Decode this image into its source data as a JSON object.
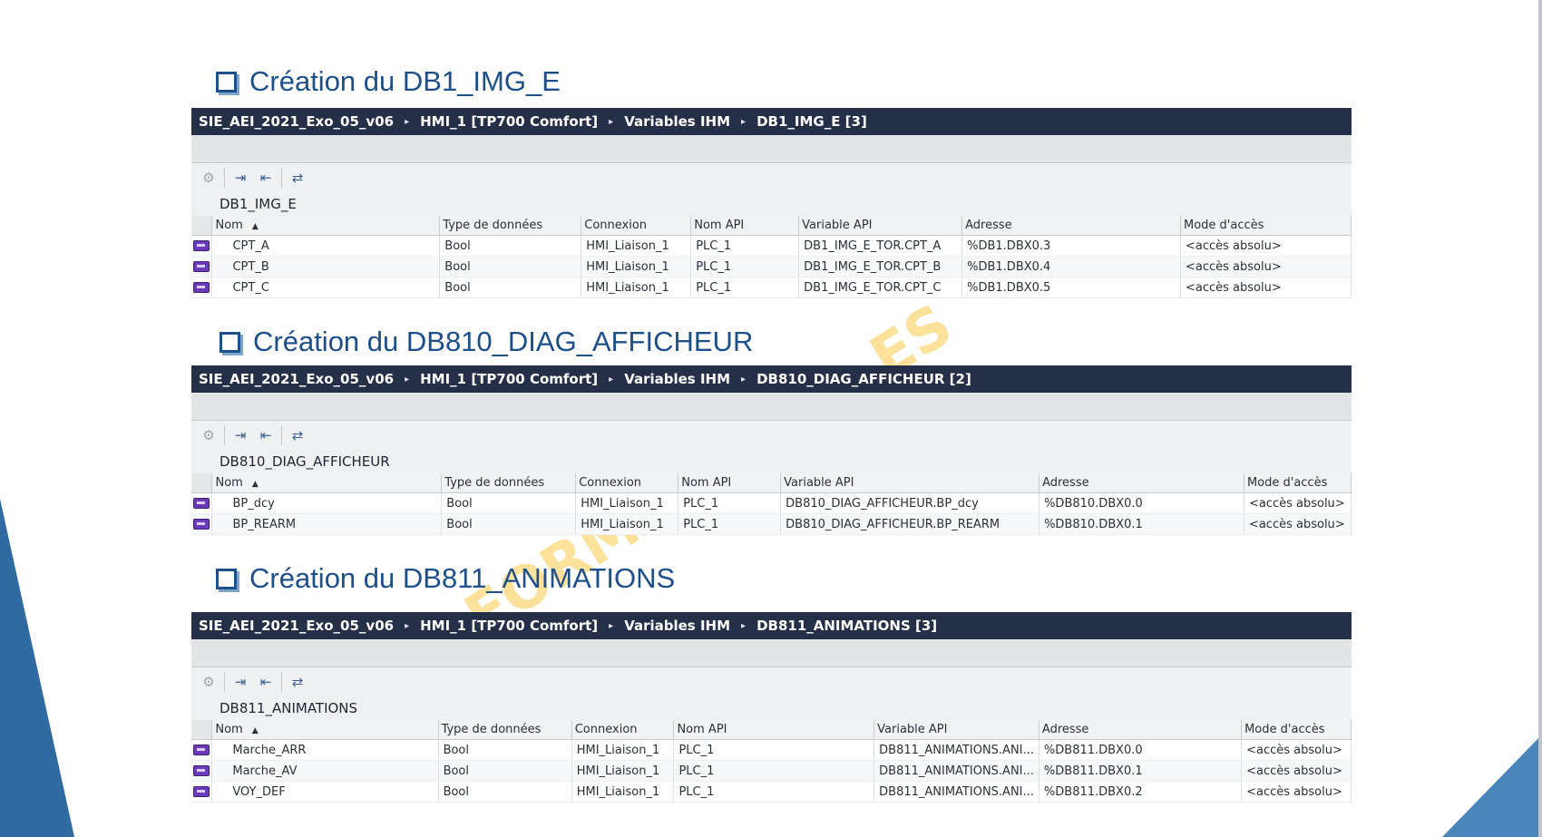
{
  "colors": {
    "title_blue": "#1d4f8a",
    "breadcrumb_bg": "#252f47",
    "accent_left": "#2f6aa0",
    "accent_right": "#4a86bb",
    "watermark": "#f8c846"
  },
  "icons": {
    "section_bullet": "checkbox-icon",
    "toolbar": [
      "settings-icon",
      "import-icon",
      "export-icon",
      "sync-icon"
    ],
    "row": "hmi-tag-icon",
    "breadcrumb_separator": "▸",
    "sort": "▲"
  },
  "watermark": {
    "top": "ES",
    "bottom": "FORMA"
  },
  "columns": [
    "Nom",
    "Type de données",
    "Connexion",
    "Nom API",
    "Variable API",
    "Adresse",
    "Mode d'accès"
  ],
  "sections": [
    {
      "title": "Création du DB1_IMG_E",
      "breadcrumb": [
        "SIE_AEI_2021_Exo_05_v06",
        "HMI_1 [TP700 Comfort]",
        "Variables IHM",
        "DB1_IMG_E [3]"
      ],
      "table_name": "DB1_IMG_E",
      "rows": [
        {
          "name": "CPT_A",
          "type": "Bool",
          "conn": "HMI_Liaison_1",
          "api": "PLC_1",
          "var": "DB1_IMG_E_TOR.CPT_A",
          "addr": "%DB1.DBX0.3",
          "mode": "<accès absolu>"
        },
        {
          "name": "CPT_B",
          "type": "Bool",
          "conn": "HMI_Liaison_1",
          "api": "PLC_1",
          "var": "DB1_IMG_E_TOR.CPT_B",
          "addr": "%DB1.DBX0.4",
          "mode": "<accès absolu>"
        },
        {
          "name": "CPT_C",
          "type": "Bool",
          "conn": "HMI_Liaison_1",
          "api": "PLC_1",
          "var": "DB1_IMG_E_TOR.CPT_C",
          "addr": "%DB1.DBX0.5",
          "mode": "<accès absolu>"
        }
      ]
    },
    {
      "title": "Création du DB810_DIAG_AFFICHEUR",
      "breadcrumb": [
        "SIE_AEI_2021_Exo_05_v06",
        "HMI_1 [TP700 Comfort]",
        "Variables IHM",
        "DB810_DIAG_AFFICHEUR [2]"
      ],
      "table_name": "DB810_DIAG_AFFICHEUR",
      "rows": [
        {
          "name": "BP_dcy",
          "type": "Bool",
          "conn": "HMI_Liaison_1",
          "api": "PLC_1",
          "var": "DB810_DIAG_AFFICHEUR.BP_dcy",
          "addr": "%DB810.DBX0.0",
          "mode": "<accès absolu>"
        },
        {
          "name": "BP_REARM",
          "type": "Bool",
          "conn": "HMI_Liaison_1",
          "api": "PLC_1",
          "var": "DB810_DIAG_AFFICHEUR.BP_REARM",
          "addr": "%DB810.DBX0.1",
          "mode": "<accès absolu>"
        }
      ]
    },
    {
      "title": "Création du DB811_ANIMATIONS",
      "breadcrumb": [
        "SIE_AEI_2021_Exo_05_v06",
        "HMI_1 [TP700 Comfort]",
        "Variables IHM",
        "DB811_ANIMATIONS [3]"
      ],
      "table_name": "DB811_ANIMATIONS",
      "rows": [
        {
          "name": "Marche_ARR",
          "type": "Bool",
          "conn": "HMI_Liaison_1",
          "api": "PLC_1",
          "var": "DB811_ANIMATIONS.ANI...",
          "addr": "%DB811.DBX0.0",
          "mode": "<accès absolu>"
        },
        {
          "name": "Marche_AV",
          "type": "Bool",
          "conn": "HMI_Liaison_1",
          "api": "PLC_1",
          "var": "DB811_ANIMATIONS.ANI...",
          "addr": "%DB811.DBX0.1",
          "mode": "<accès absolu>"
        },
        {
          "name": "VOY_DEF",
          "type": "Bool",
          "conn": "HMI_Liaison_1",
          "api": "PLC_1",
          "var": "DB811_ANIMATIONS.ANI...",
          "addr": "%DB811.DBX0.2",
          "mode": "<accès absolu>"
        }
      ]
    }
  ]
}
